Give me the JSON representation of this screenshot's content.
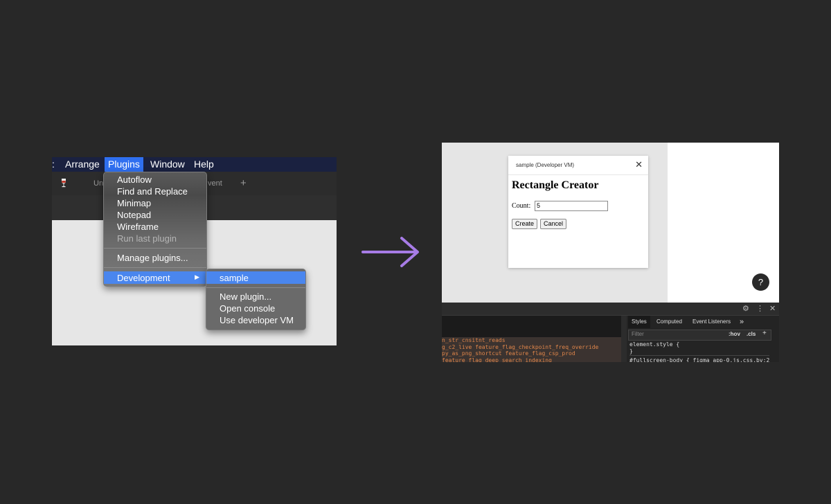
{
  "left": {
    "menubar": {
      "items": [
        ":",
        "Arrange",
        "Plugins",
        "Window",
        "Help"
      ],
      "active": "Plugins"
    },
    "toolbar": {
      "file_tab_partial": "Un",
      "tab_partial_right": "vent",
      "add_icon": "+"
    },
    "plugins_menu": {
      "items": [
        "Autoflow",
        "Find and Replace",
        "Minimap",
        "Notepad",
        "Wireframe"
      ],
      "disabled_item": "Run last plugin",
      "manage": "Manage plugins...",
      "development": "Development"
    },
    "dev_submenu": {
      "highlighted": "sample",
      "items": [
        "New plugin...",
        "Open console",
        "Use developer VM"
      ]
    }
  },
  "right": {
    "plugin_window": {
      "title": "sample (Developer VM)",
      "heading": "Rectangle Creator",
      "count_label": "Count:",
      "count_value": "5",
      "create_label": "Create",
      "cancel_label": "Cancel"
    },
    "help_label": "?",
    "devtools": {
      "tabs": [
        "Styles",
        "Computed",
        "Event Listeners"
      ],
      "more_tabs": "»",
      "filter_placeholder": "Filter",
      "hov": ":hov",
      "cls": ".cls",
      "add": "+",
      "code_lines": [
        "element.style {",
        "}",
        "#fullscreen-body {     figma_app-0.js.css.bv:2"
      ],
      "console_lines": [
        "n_str_cnsitnt_reads",
        "g_c2_live feature_flag_checkpoint_freq_override",
        "py_as_png_shortcut feature_flag_csp_prod",
        "feature_flag_deep_search_indexing"
      ]
    }
  },
  "colors": {
    "background": "#282828",
    "menu_highlight": "#4a86ee",
    "arrow": "#a77ce6",
    "console_text": "#e0864a"
  }
}
